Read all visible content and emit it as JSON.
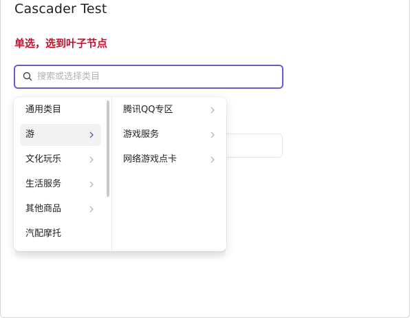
{
  "page": {
    "title": "Cascader Test",
    "section_label": "单选，选到叶子节点"
  },
  "search": {
    "placeholder": "搜索或选择类目",
    "value": ""
  },
  "cascader": {
    "left_column": [
      {
        "label": "通用类目",
        "has_children": false,
        "active": false
      },
      {
        "label": "游",
        "has_children": true,
        "active": true
      },
      {
        "label": "文化玩乐",
        "has_children": true,
        "active": false
      },
      {
        "label": "生活服务",
        "has_children": true,
        "active": false
      },
      {
        "label": "其他商品",
        "has_children": true,
        "active": false
      },
      {
        "label": "汽配摩托",
        "has_children": false,
        "active": false
      }
    ],
    "right_column": [
      {
        "label": "腾讯QQ专区",
        "has_children": true
      },
      {
        "label": "游戏服务",
        "has_children": true
      },
      {
        "label": "网络游戏点卡",
        "has_children": true
      }
    ]
  },
  "colors": {
    "accent": "#6a5acd",
    "section_label": "#c8102e"
  },
  "icons": {
    "search": "search-icon",
    "chevron": "chevron-right-icon"
  }
}
